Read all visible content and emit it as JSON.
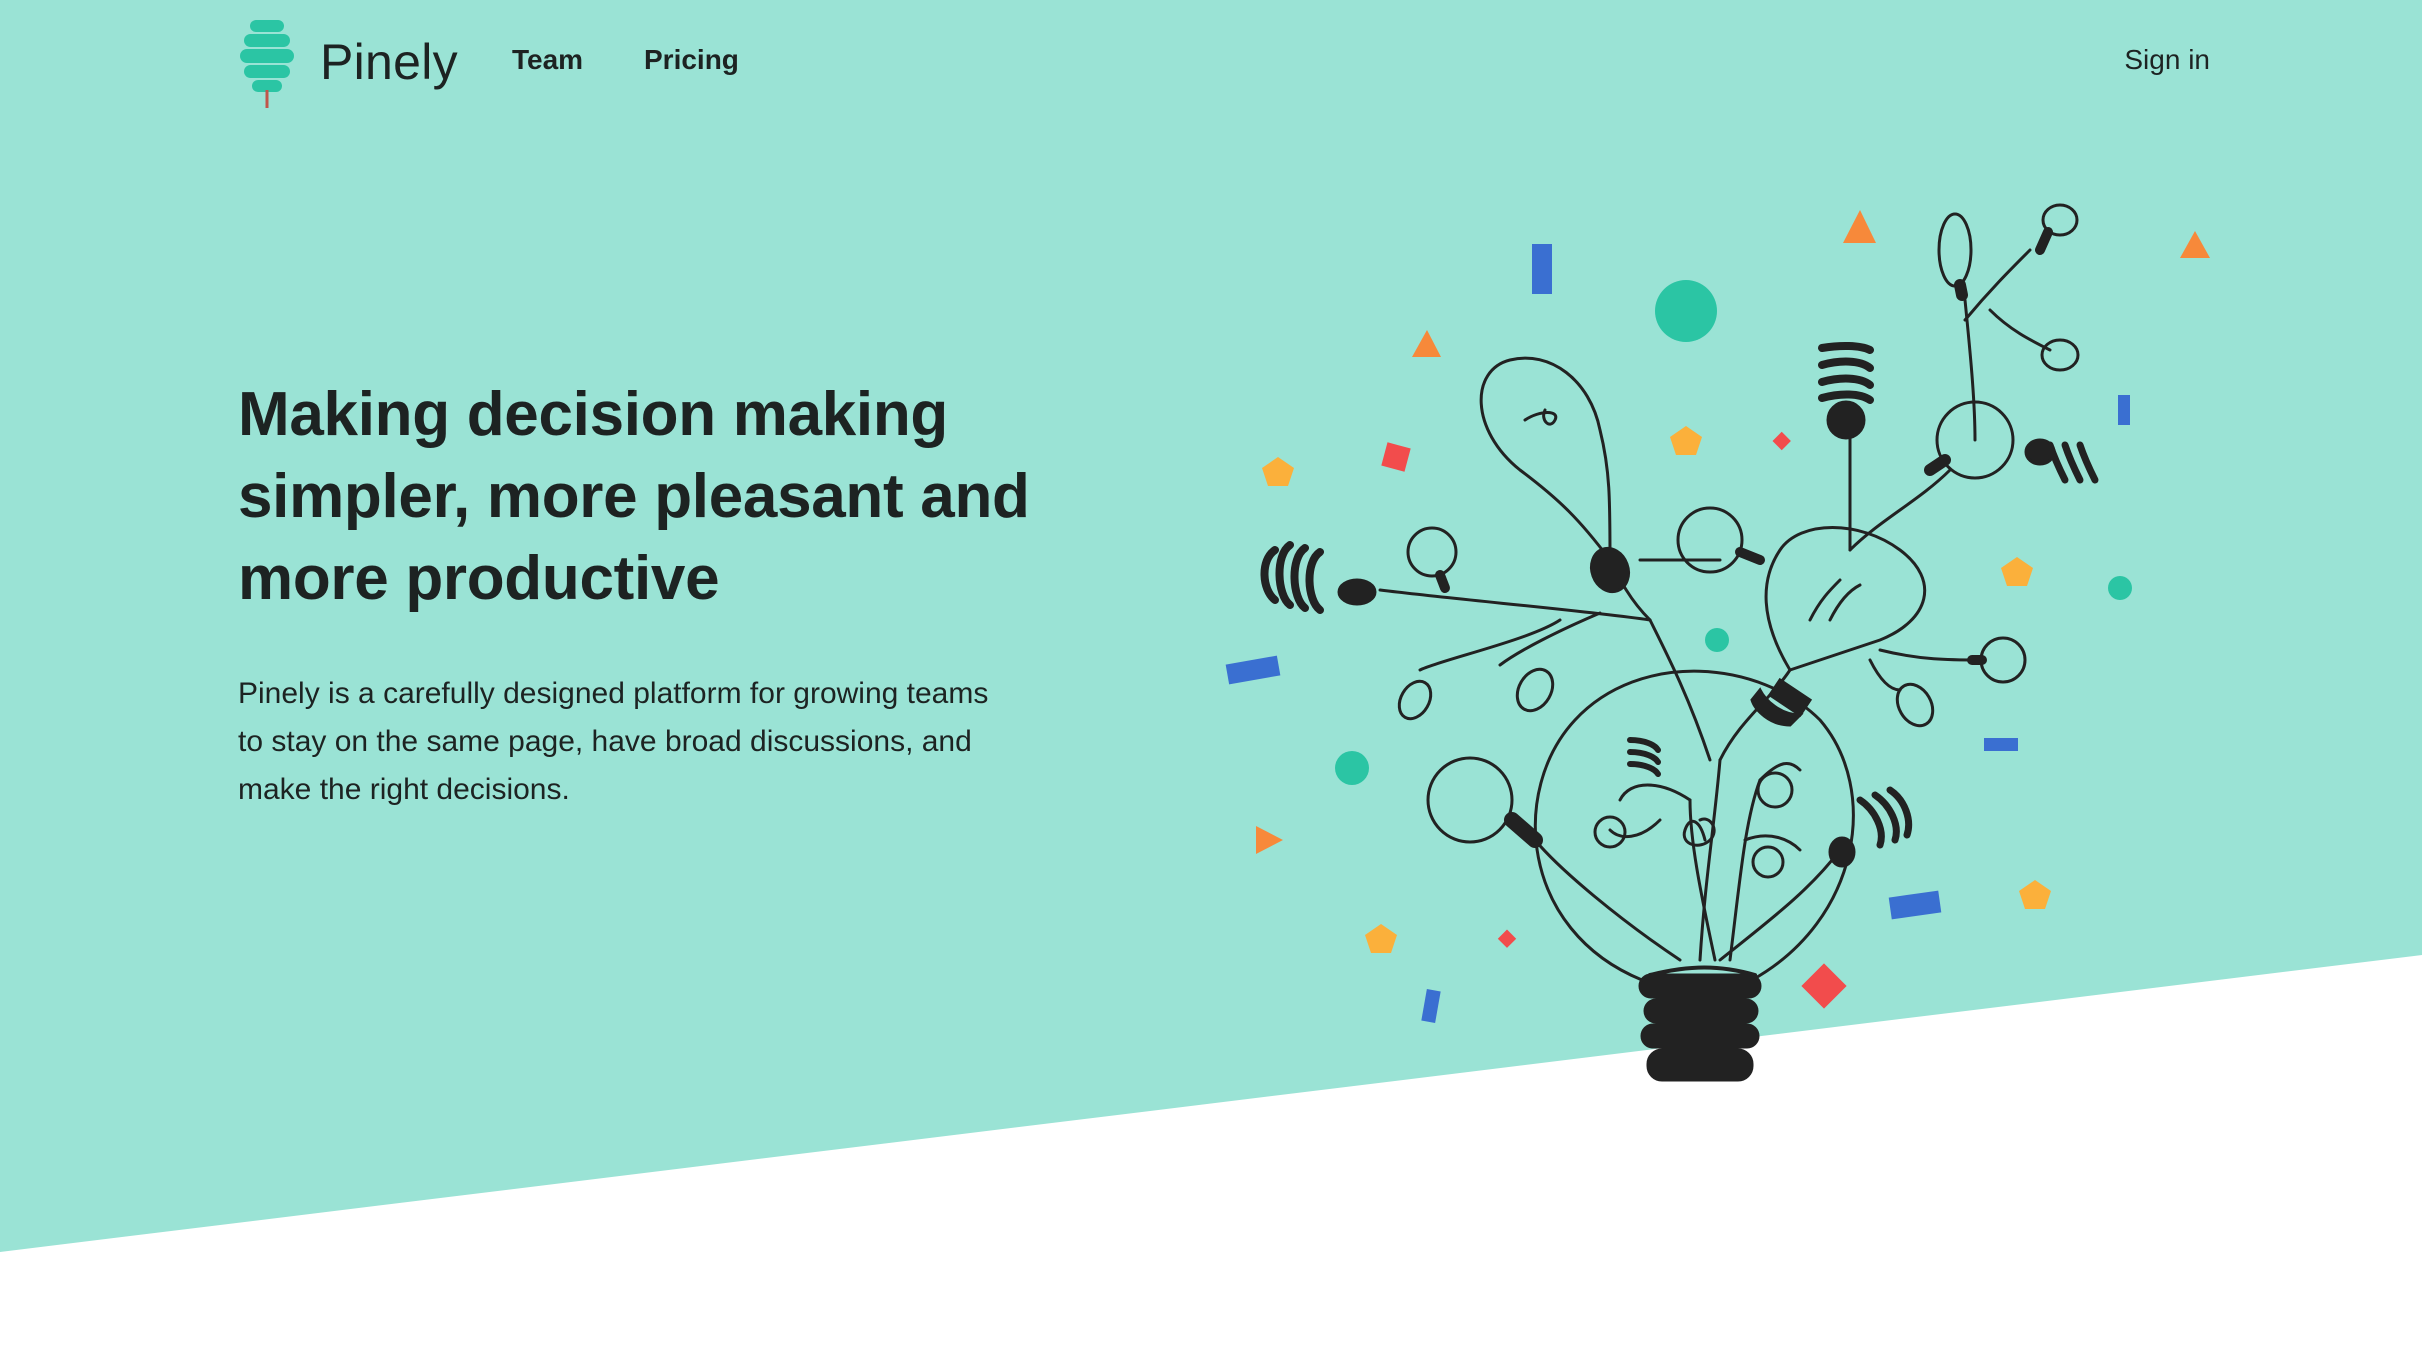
{
  "brand": {
    "name": "Pinely",
    "logo_icon": "pine-tree-logo",
    "color": "#2bc5a4"
  },
  "nav": {
    "links": [
      {
        "label": "Team"
      },
      {
        "label": "Pricing"
      }
    ],
    "sign_in": "Sign in"
  },
  "hero": {
    "title": "Making decision making simpler, more pleasant and more productive",
    "description": "Pinely is a carefully designed platform for growing teams to stay on the same page, have broad discussions, and make the right decisions.",
    "illustration": "lightbulb-ideas-illustration"
  },
  "colors": {
    "hero_background": "#9ae3d5",
    "page_background": "#ffffff",
    "text": "#1d2322",
    "accent_teal": "#2bc5a4",
    "confetti_orange": "#f7893a",
    "confetti_yellow": "#fbb03b",
    "confetti_red": "#f24c4c",
    "confetti_blue": "#3a6fd1"
  }
}
